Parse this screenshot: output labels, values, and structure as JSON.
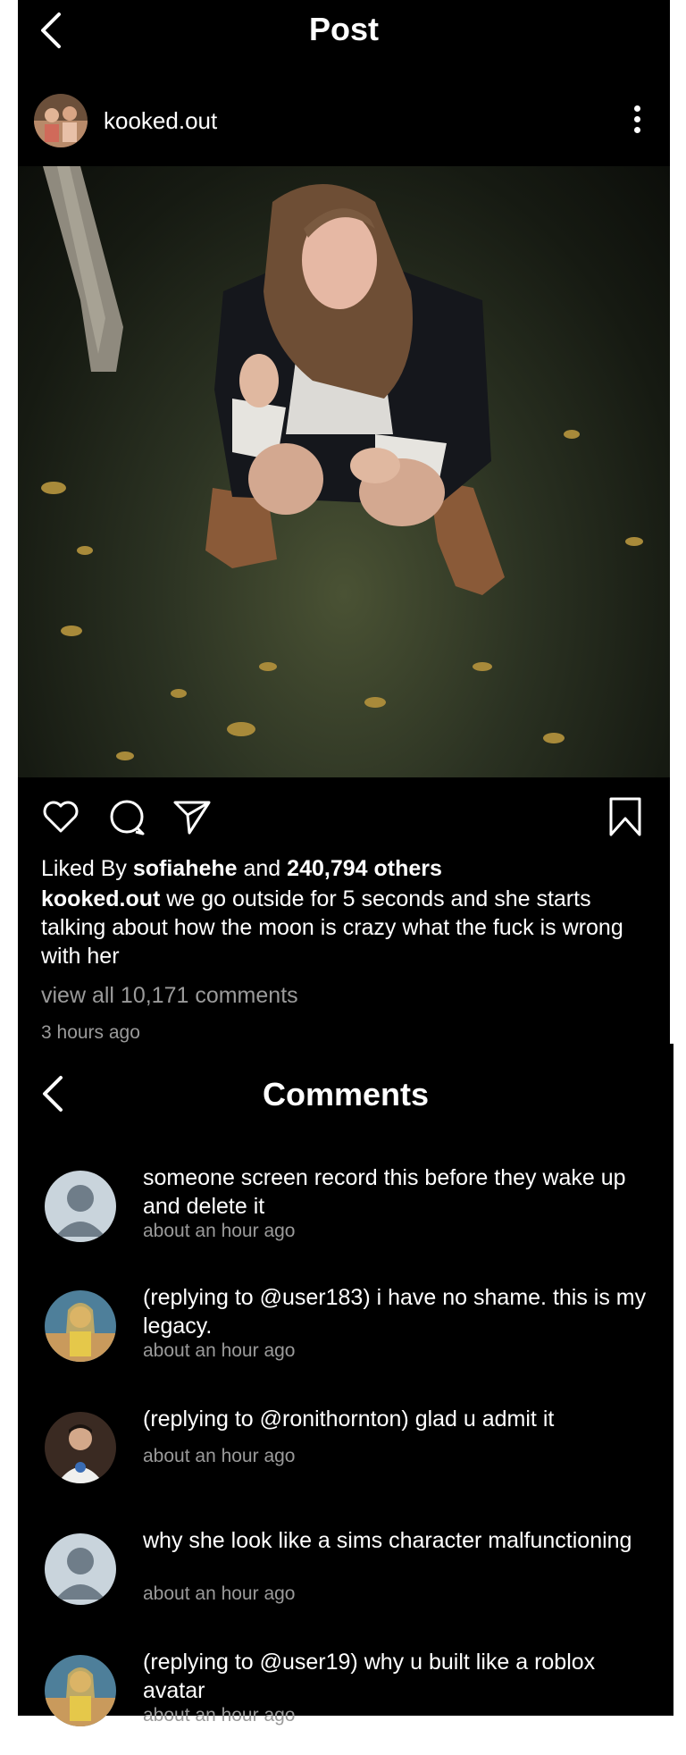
{
  "post": {
    "title": "Post",
    "author": "kooked.out",
    "liked_by_prefix": "Liked By",
    "liked_by_user": "sofiahehe",
    "liked_by_and": "and",
    "likes_count": "240,794 others",
    "caption_author": "kooked.out",
    "caption": "we go outside for 5 seconds and she starts talking about how the moon is crazy what the fuck is wrong with her",
    "view_comments": "view all 10,171 comments",
    "time": "3 hours ago"
  },
  "comments_panel": {
    "title": "Comments",
    "items": [
      {
        "text": "someone screen record this before they wake up and delete it",
        "time": "about an hour ago",
        "avatar": "default-avatar"
      },
      {
        "text": "(replying to @user183) i have no shame. this is my legacy.",
        "time": "about an hour ago",
        "avatar": "photo-avatar"
      },
      {
        "text": "(replying to @ronithornton) glad u admit it",
        "time": "about an hour ago",
        "avatar": "photo-avatar"
      },
      {
        "text": "why she look like a sims character malfunctioning",
        "time": "about an hour ago",
        "avatar": "default-avatar"
      },
      {
        "text": "(replying to @user19) why u built like a roblox avatar",
        "time": "about an hour ago",
        "avatar": "photo-avatar"
      }
    ]
  },
  "colors": {
    "background": "#000000",
    "text": "#ffffff",
    "muted": "#9a9a9a",
    "avatar_placeholder_bg": "#c9d4dc",
    "avatar_placeholder_fg": "#6f7d89"
  }
}
